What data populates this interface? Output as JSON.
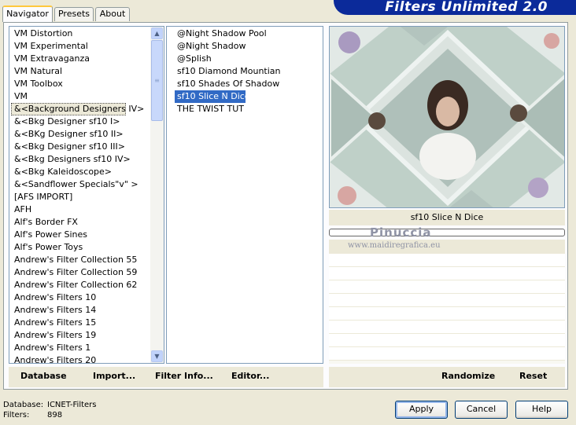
{
  "tabs": [
    "Navigator",
    "Presets",
    "About"
  ],
  "title": "Filters Unlimited 2.0",
  "categories": [
    "VM Distortion",
    "VM Experimental",
    "VM Extravaganza",
    "VM Natural",
    "VM Toolbox",
    "VM",
    "&<Background Designers IV>",
    "&<Bkg Designer sf10 I>",
    "&<BKg Designer sf10 II>",
    "&<Bkg Designer sf10 III>",
    "&<Bkg Designers sf10 IV>",
    "&<Bkg Kaleidoscope>",
    "&<Sandflower Specials\"v\" >",
    "[AFS IMPORT]",
    "AFH",
    "Alf's Border FX",
    "Alf's Power Sines",
    "Alf's Power Toys",
    "Andrew's Filter Collection 55",
    "Andrew's Filter Collection 59",
    "Andrew's Filter Collection 62",
    "Andrew's Filters 10",
    "Andrew's Filters 14",
    "Andrew's Filters 15",
    "Andrew's Filters 19",
    "Andrew's Filters 1",
    "Andrew's Filters 20"
  ],
  "filters": [
    "@Night Shadow Pool",
    "@Night Shadow",
    "@Splish",
    "sf10 Diamond Mountian",
    "sf10 Shades Of Shadow",
    "sf10 Slice N Dice",
    "THE TWIST TUT"
  ],
  "selected_filter": "sf10 Slice N Dice",
  "filter_name": "sf10 Slice N Dice",
  "watermark": {
    "name": "Pinuccia",
    "url": "www.maidiregrafica.eu"
  },
  "buttons": {
    "database": "Database",
    "import": "Import...",
    "filter_info": "Filter Info...",
    "editor": "Editor...",
    "randomize": "Randomize",
    "reset": "Reset",
    "apply": "Apply",
    "cancel": "Cancel",
    "help": "Help"
  },
  "footer": {
    "database_label": "Database:",
    "database_value": "ICNET-Filters",
    "filters_label": "Filters:",
    "filters_value": "898"
  }
}
